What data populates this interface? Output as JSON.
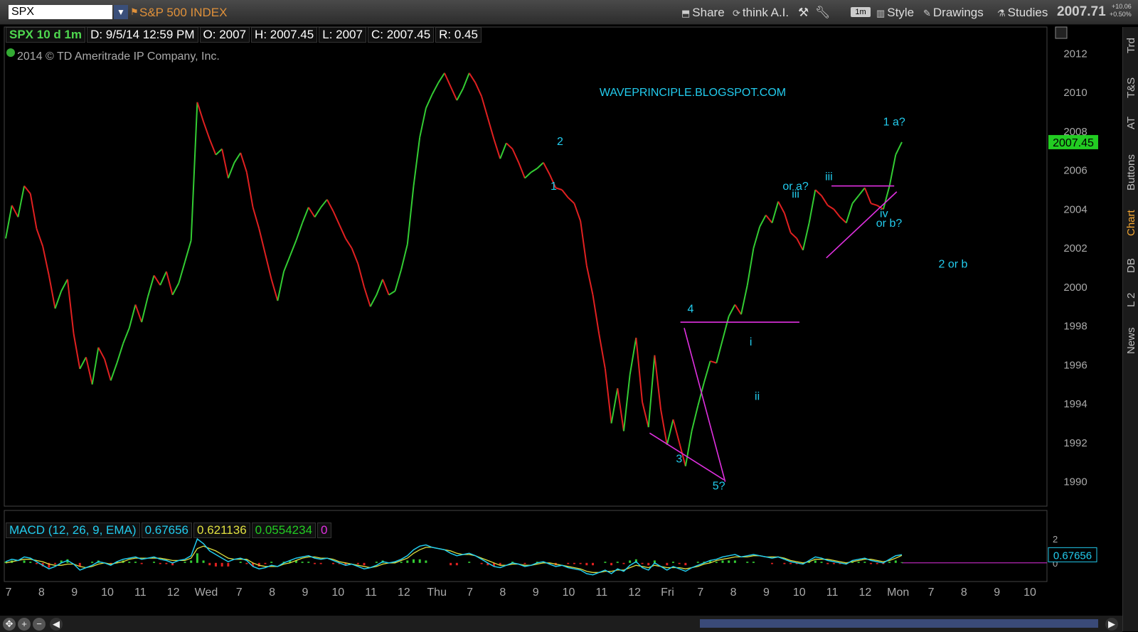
{
  "toolbar": {
    "symbol": "SPX",
    "description": "S&P 500 INDEX",
    "share": "Share",
    "think": "think A.I.",
    "interval_badge": "1m",
    "style": "Style",
    "drawings": "Drawings",
    "studies": "Studies",
    "last_price": "2007.71",
    "change_abs": "+10.06",
    "change_pct": "+0.50%"
  },
  "info": {
    "symbol": "SPX 10 d 1m",
    "date": "D: 9/5/14 12:59 PM",
    "open": "O: 2007",
    "high": "H: 2007.45",
    "low": "L: 2007",
    "close": "C: 2007.45",
    "range": "R: 0.45"
  },
  "copyright": "2014 © TD Ameritrade IP Company, Inc.",
  "watermark": "WAVEPRINCIPLE.BLOGSPOT.COM",
  "macd": {
    "label": "MACD (12, 26, 9, EMA)",
    "value": "0.67656",
    "avg": "0.621136",
    "diff": "0.0554234",
    "zero": "0"
  },
  "right_tabs": [
    "Trd",
    "T&S",
    "AT",
    "Buttons",
    "Chart",
    "DB",
    "L 2",
    "News"
  ],
  "colors": {
    "up": "#33cc33",
    "down": "#e02020",
    "wave_label": "#22ccee",
    "trendline": "#e030e0",
    "price_badge": "#22cc22"
  },
  "chart_data": [
    {
      "type": "line",
      "title": "",
      "y_ticks": [
        1990,
        1992,
        1994,
        1996,
        1998,
        2000,
        2002,
        2004,
        2006,
        2008,
        2010,
        2012
      ],
      "ylim": [
        1989,
        2013
      ],
      "x_ticks": [
        "7",
        "8",
        "9",
        "10",
        "11",
        "12",
        "Wed",
        "7",
        "8",
        "9",
        "10",
        "11",
        "12",
        "Thu",
        "7",
        "8",
        "9",
        "10",
        "11",
        "12",
        "Fri",
        "7",
        "8",
        "9",
        "10",
        "11",
        "12",
        "Mon",
        "7",
        "8",
        "9",
        "10"
      ],
      "current_price_label": "2007.45",
      "series": [
        {
          "values": [
            2002.5,
            2004.2,
            2003.6,
            2005.2,
            2004.8,
            2003.0,
            2002.1,
            2000.6,
            1998.9,
            1999.8,
            2000.4,
            1997.6,
            1995.8,
            1996.4,
            1995.0,
            1996.9,
            1996.3,
            1995.2,
            1996.1,
            1997.1,
            1997.9,
            1999.1,
            1998.2,
            1999.5,
            2000.6,
            2000.1,
            2000.8,
            1999.6,
            2000.2,
            2001.3,
            2002.4,
            2009.5,
            2008.5,
            2007.6,
            2006.8,
            2007.1,
            2005.6,
            2006.4,
            2006.9,
            2005.9,
            2004.1,
            2003.0,
            2001.7,
            2000.4,
            1999.3,
            2000.8,
            2001.6,
            2002.4,
            2003.3,
            2004.1,
            2003.6,
            2004.1,
            2004.5,
            2003.9,
            2003.2,
            2002.5,
            2002.0,
            2001.2,
            2000.0,
            1999.0,
            1999.6,
            2000.4,
            1999.6,
            1999.8,
            2000.9,
            2002.2,
            2005.2,
            2007.7,
            2009.2,
            2009.9,
            2010.5,
            2011.0,
            2010.3,
            2009.6,
            2010.2,
            2011.0,
            2010.5,
            2009.8,
            2008.7,
            2007.6,
            2006.6,
            2007.4,
            2007.1,
            2006.4,
            2005.6,
            2005.9,
            2006.1,
            2006.4,
            2005.8,
            2005.1,
            2005.0,
            2004.6,
            2004.3,
            2003.4,
            2001.1,
            1999.6,
            1997.6,
            1995.8,
            1993.0,
            1994.8,
            1992.6,
            1995.5,
            1997.4,
            1994.1,
            1992.8,
            1996.5,
            1993.7,
            1991.9,
            1993.2,
            1992.0,
            1990.8,
            1992.6,
            1993.9,
            1995.1,
            1996.2,
            1996.1,
            1997.3,
            1998.5,
            1999.1,
            1998.6,
            2000.1,
            2002.0,
            2003.1,
            2003.7,
            2003.3,
            2004.4,
            2003.8,
            2002.8,
            2002.5,
            2001.9,
            2003.3,
            2005.0,
            2004.7,
            2004.2,
            2004.0,
            2003.6,
            2003.3,
            2004.3,
            2004.7,
            2005.1,
            2004.3,
            2004.2,
            2004.0,
            2005.2,
            2006.8,
            2007.45
          ]
        }
      ],
      "annotations": [
        {
          "text": "1",
          "x": 4.28,
          "y": 2005.0
        },
        {
          "text": "2",
          "x": 4.33,
          "y": 2007.3
        },
        {
          "text": "4",
          "x": 5.35,
          "y": 1998.7
        },
        {
          "text": "3",
          "x": 5.26,
          "y": 1991.0
        },
        {
          "text": "5?",
          "x": 5.57,
          "y": 1989.6
        },
        {
          "text": "i",
          "x": 5.82,
          "y": 1997.0
        },
        {
          "text": "ii",
          "x": 5.87,
          "y": 1994.2
        },
        {
          "text": "or a?",
          "x": 6.17,
          "y": 2005.0
        },
        {
          "text": "iii",
          "x": 6.17,
          "y": 2004.6
        },
        {
          "text": "iii",
          "x": 6.43,
          "y": 2005.5
        },
        {
          "text": "iv",
          "x": 6.86,
          "y": 2003.6
        },
        {
          "text": "or b?",
          "x": 6.9,
          "y": 2003.1
        },
        {
          "text": "1 a?",
          "x": 6.94,
          "y": 2008.3
        },
        {
          "text": "2 or b",
          "x": 7.4,
          "y": 2001.0
        }
      ],
      "trendlines": [
        {
          "from": [
            5.27,
            1998.2
          ],
          "to": [
            6.2,
            1998.2
          ]
        },
        {
          "from": [
            5.3,
            1997.9
          ],
          "to": [
            5.62,
            1990.0
          ]
        },
        {
          "from": [
            5.03,
            1992.5
          ],
          "to": [
            5.61,
            1990.1
          ]
        },
        {
          "from": [
            6.45,
            2005.2
          ],
          "to": [
            6.94,
            2005.2
          ]
        },
        {
          "from": [
            6.41,
            2001.5
          ],
          "to": [
            6.96,
            2004.9
          ]
        }
      ]
    },
    {
      "type": "line",
      "title": "MACD (12, 26, 9, EMA)",
      "y_ticks": [
        0,
        1,
        2
      ],
      "ylim": [
        -1.2,
        2.6
      ],
      "current_value_label": "0.67656",
      "series": [
        {
          "name": "Value",
          "values": [
            0.1,
            0.3,
            0.2,
            0.5,
            0.4,
            0.1,
            -0.2,
            -0.5,
            -0.3,
            0.0,
            0.2,
            -0.1,
            -0.6,
            -0.4,
            -0.2,
            0.1,
            0.0,
            -0.2,
            0.1,
            0.3,
            0.4,
            0.5,
            0.3,
            0.4,
            0.5,
            0.3,
            0.2,
            0.0,
            0.2,
            0.3,
            0.6,
            2.0,
            1.6,
            1.0,
            0.7,
            0.4,
            0.1,
            0.3,
            0.4,
            0.2,
            -0.3,
            -0.5,
            -0.4,
            -0.2,
            -0.3,
            0.0,
            0.2,
            0.4,
            0.5,
            0.6,
            0.4,
            0.3,
            0.4,
            0.2,
            0.0,
            -0.2,
            -0.1,
            -0.3,
            -0.5,
            -0.4,
            -0.2,
            0.1,
            0.0,
            0.1,
            0.3,
            0.6,
            1.1,
            1.4,
            1.5,
            1.3,
            1.2,
            1.1,
            0.8,
            0.6,
            0.7,
            0.8,
            0.6,
            0.3,
            0.0,
            -0.3,
            -0.4,
            -0.2,
            0.0,
            -0.1,
            -0.3,
            -0.2,
            0.0,
            0.1,
            -0.1,
            -0.3,
            -0.2,
            -0.4,
            -0.5,
            -0.6,
            -0.9,
            -1.0,
            -0.8,
            -0.6,
            -0.9,
            -0.5,
            -0.7,
            -0.2,
            0.1,
            -0.4,
            -0.6,
            0.0,
            -0.3,
            -0.6,
            -0.3,
            -0.5,
            -0.7,
            -0.4,
            -0.2,
            0.0,
            0.2,
            0.3,
            0.5,
            0.6,
            0.7,
            0.5,
            0.6,
            0.7,
            0.6,
            0.5,
            0.4,
            0.5,
            0.3,
            0.1,
            0.0,
            -0.1,
            0.2,
            0.5,
            0.4,
            0.2,
            0.1,
            0.0,
            -0.1,
            0.2,
            0.3,
            0.4,
            0.2,
            0.1,
            0.0,
            0.3,
            0.6,
            0.68
          ]
        },
        {
          "name": "Avg",
          "values": [
            0.0,
            0.1,
            0.2,
            0.3,
            0.3,
            0.2,
            0.1,
            -0.1,
            -0.2,
            -0.2,
            -0.1,
            -0.1,
            -0.3,
            -0.4,
            -0.3,
            -0.1,
            0.0,
            -0.1,
            0.0,
            0.1,
            0.3,
            0.4,
            0.4,
            0.4,
            0.4,
            0.4,
            0.3,
            0.2,
            0.2,
            0.2,
            0.4,
            1.2,
            1.4,
            1.2,
            1.0,
            0.7,
            0.4,
            0.3,
            0.3,
            0.3,
            0.0,
            -0.2,
            -0.3,
            -0.3,
            -0.3,
            -0.1,
            0.0,
            0.2,
            0.4,
            0.5,
            0.5,
            0.4,
            0.4,
            0.3,
            0.1,
            0.0,
            -0.1,
            -0.2,
            -0.3,
            -0.4,
            -0.3,
            -0.1,
            0.0,
            0.0,
            0.2,
            0.4,
            0.8,
            1.1,
            1.3,
            1.3,
            1.2,
            1.1,
            1.0,
            0.8,
            0.7,
            0.7,
            0.6,
            0.4,
            0.2,
            0.0,
            -0.2,
            -0.2,
            -0.1,
            -0.1,
            -0.2,
            -0.2,
            -0.1,
            0.0,
            0.0,
            -0.1,
            -0.2,
            -0.3,
            -0.4,
            -0.5,
            -0.7,
            -0.8,
            -0.8,
            -0.7,
            -0.7,
            -0.6,
            -0.6,
            -0.4,
            -0.2,
            -0.3,
            -0.4,
            -0.2,
            -0.3,
            -0.4,
            -0.4,
            -0.4,
            -0.5,
            -0.4,
            -0.3,
            -0.1,
            0.0,
            0.2,
            0.3,
            0.4,
            0.5,
            0.5,
            0.5,
            0.6,
            0.6,
            0.5,
            0.5,
            0.5,
            0.4,
            0.2,
            0.1,
            0.0,
            0.1,
            0.3,
            0.3,
            0.3,
            0.2,
            0.1,
            0.0,
            0.1,
            0.2,
            0.3,
            0.3,
            0.2,
            0.1,
            0.2,
            0.4,
            0.62
          ]
        }
      ]
    }
  ]
}
